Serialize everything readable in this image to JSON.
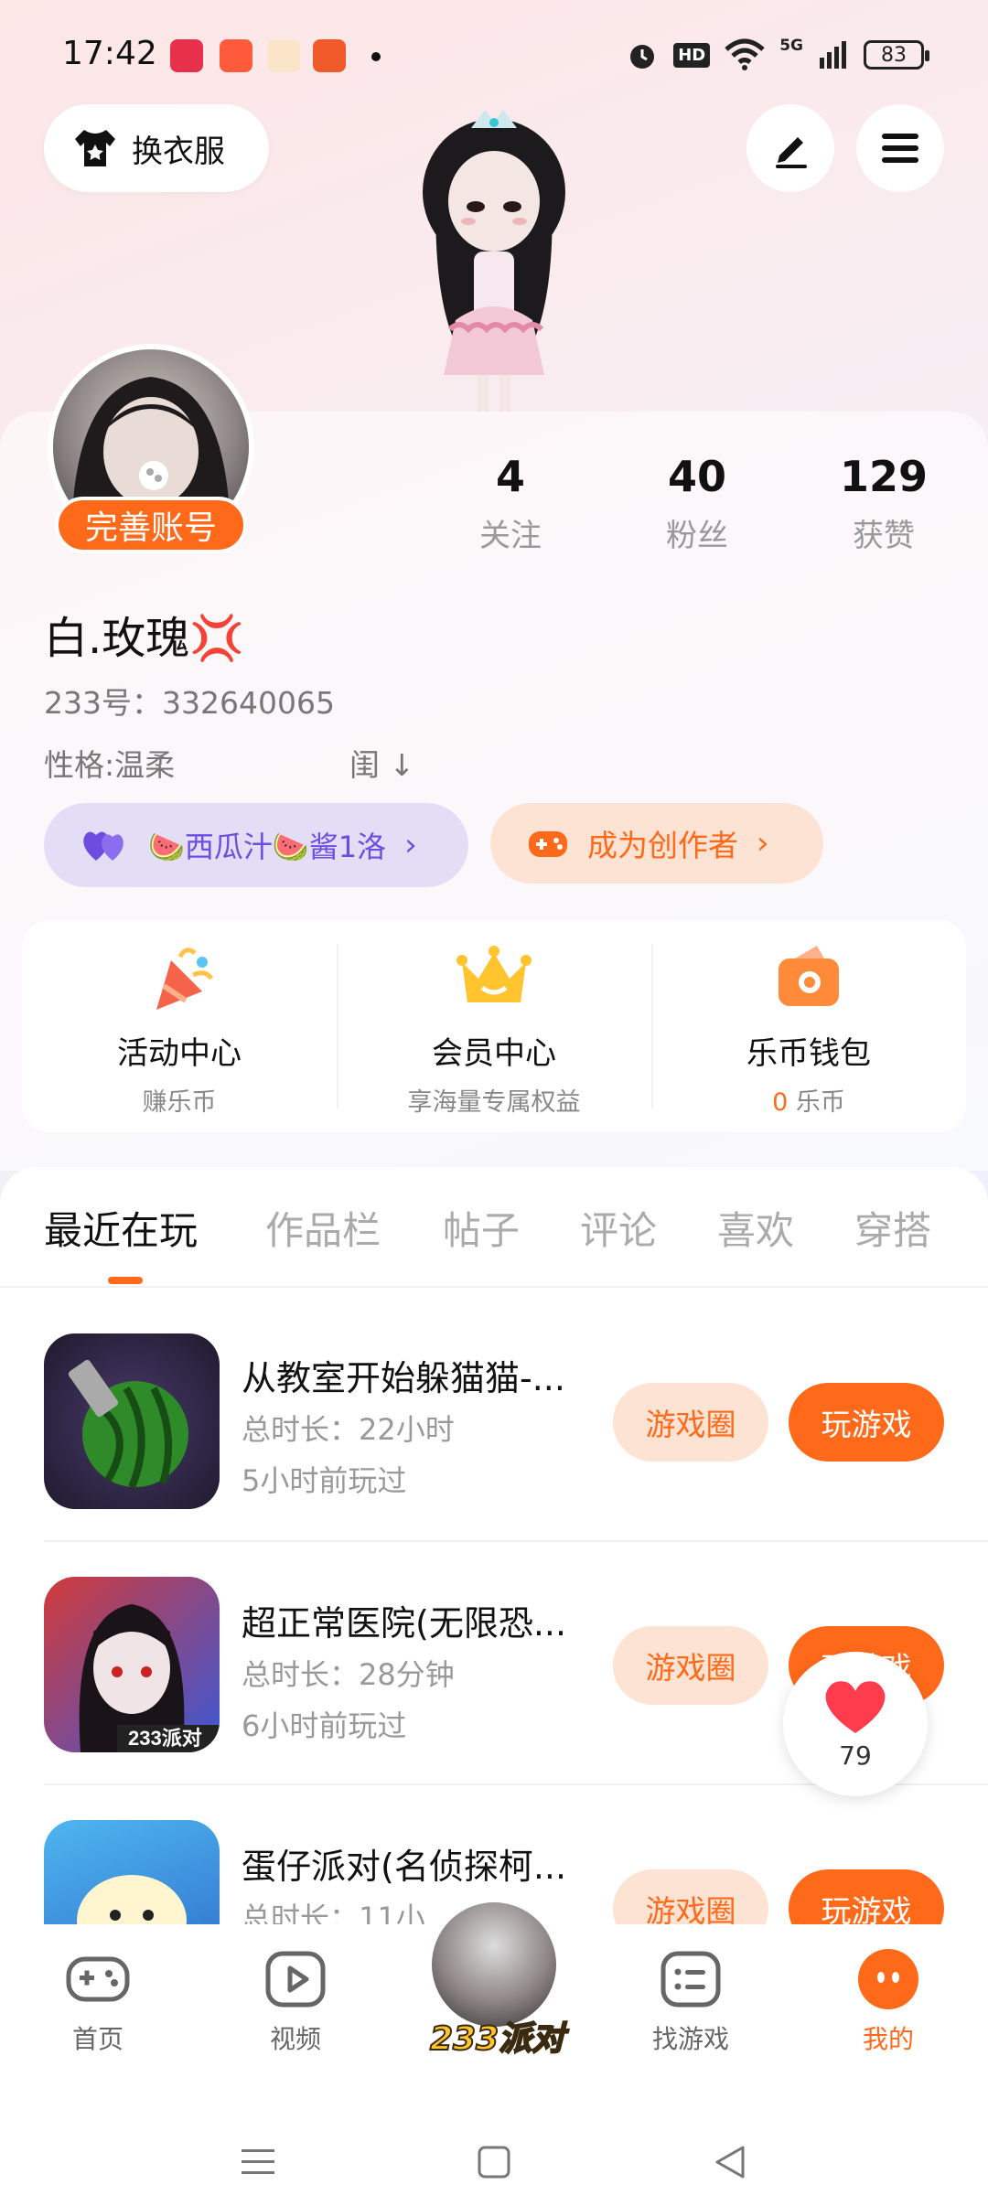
{
  "status_bar": {
    "time": "17:42",
    "battery": "83",
    "network": "5G",
    "hd": "HD"
  },
  "top": {
    "outfit_label": "换衣服"
  },
  "profile": {
    "complete_badge": "完善账号",
    "stats": [
      {
        "num": "4",
        "label": "关注"
      },
      {
        "num": "40",
        "label": "粉丝"
      },
      {
        "num": "129",
        "label": "获赞"
      }
    ],
    "username": "白.玫瑰💢",
    "id_line": "233号：332640065",
    "personality": "性格:温柔",
    "sort_label": "闺 ↓",
    "group_chip": "🍉西瓜汁🍉酱1洛",
    "creator_chip": "成为创作者"
  },
  "services": [
    {
      "title": "活动中心",
      "sub": "赚乐币"
    },
    {
      "title": "会员中心",
      "sub": "享海量专属权益"
    },
    {
      "title": "乐币钱包",
      "sub_num": "0",
      "sub": " 乐币"
    }
  ],
  "tabs": [
    "最近在玩",
    "作品栏",
    "帖子",
    "评论",
    "喜欢",
    "穿搭"
  ],
  "games": [
    {
      "title": "从教室开始躲猫猫-...",
      "duration": "总时长：22小时",
      "last_played": "5小时前玩过",
      "circle_btn": "游戏圈",
      "play_btn": "玩游戏"
    },
    {
      "title": "超正常医院(无限恐...",
      "duration": "总时长：28分钟",
      "last_played": "6小时前玩过",
      "circle_btn": "游戏圈",
      "play_btn": "玩游戏"
    },
    {
      "title": "蛋仔派对(名侦探柯...",
      "duration": "总时长：11小",
      "last_played": "",
      "circle_btn": "游戏圈",
      "play_btn": "玩游戏"
    }
  ],
  "like_float": {
    "count": "79"
  },
  "bottom_nav": [
    {
      "label": "首页"
    },
    {
      "label": "视频"
    },
    {
      "label": "233派对"
    },
    {
      "label": "找游戏"
    },
    {
      "label": "我的"
    }
  ],
  "colors": {
    "accent": "#ff6a1a",
    "purple": "#6d4de0"
  }
}
